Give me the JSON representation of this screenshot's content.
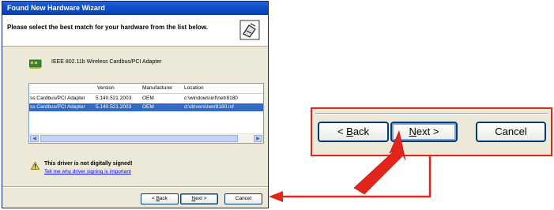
{
  "window": {
    "title": "Found New Hardware Wizard",
    "header_text": "Please select the best match for your hardware from the list below."
  },
  "device": {
    "name": "IEEE 802.11b Wireless Cardbus/PCI Adapter",
    "icon": "network-card-icon"
  },
  "list": {
    "columns": [
      "Version",
      "Manufacturer",
      "Location"
    ],
    "rows": [
      {
        "name": "ss Cardbus/PCI Adapter",
        "version": "5.140.521.2003",
        "manufacturer": "OEM",
        "location": "c:\\windows\\inf\\netr8180",
        "selected": false
      },
      {
        "name": "ss Cardbus/PCI Adapter",
        "version": "5.140.521.2003",
        "manufacturer": "OEM",
        "location": "d:\\drivers\\netr8180.inf",
        "selected": true
      }
    ]
  },
  "warning": {
    "icon": "warning-icon",
    "text": "This driver is not digitally signed!",
    "link": "Tell me why driver signing is important"
  },
  "buttons": {
    "back_pre": "< ",
    "back_key": "B",
    "back_rest": "ack",
    "next_key": "N",
    "next_rest": "ext >",
    "cancel": "Cancel"
  },
  "colors": {
    "callout_red": "#e3241b",
    "titlebar_blue": "#0a3fb0",
    "selection_blue": "#316ac5"
  }
}
